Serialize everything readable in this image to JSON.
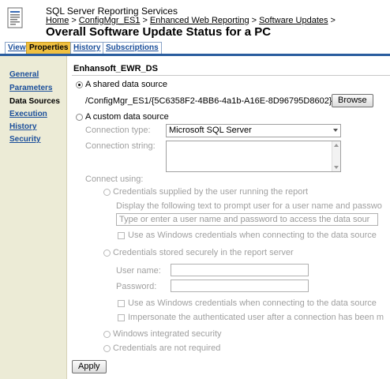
{
  "header": {
    "app_title": "SQL Server Reporting Services",
    "breadcrumbs": [
      "Home",
      "ConfigMgr_ES1",
      "Enhanced Web Reporting",
      "Software Updates"
    ],
    "separator": ">",
    "page_title": "Overall Software Update Status for a PC"
  },
  "tabs": [
    {
      "label": "View"
    },
    {
      "label": "Properties"
    },
    {
      "label": "History"
    },
    {
      "label": "Subscriptions"
    }
  ],
  "sidebar": {
    "items": [
      {
        "label": "General"
      },
      {
        "label": "Parameters"
      },
      {
        "label": "Data Sources"
      },
      {
        "label": "Execution"
      },
      {
        "label": "History"
      },
      {
        "label": "Security"
      }
    ]
  },
  "form": {
    "datasource_name": "Enhansoft_EWR_DS",
    "shared_label": "A shared data source",
    "shared_path": "/ConfigMgr_ES1/{5C6358F2-4BB6-4a1b-A16E-8D96795D8602}",
    "browse_label": "Browse",
    "custom_label": "A custom data source",
    "connection_type_label": "Connection type:",
    "connection_type_value": "Microsoft SQL Server",
    "connection_string_label": "Connection string:",
    "connect_using_label": "Connect using:",
    "cred_user_label": "Credentials supplied by the user running the report",
    "prompt_text_label": "Display the following text to prompt user for a user name and passwo",
    "prompt_placeholder": "Type or enter a user name and password to access the data sour",
    "use_windows_1": "Use as Windows credentials when connecting to the data source",
    "cred_stored_label": "Credentials stored securely in the report server",
    "username_label": "User name:",
    "password_label": "Password:",
    "use_windows_2": "Use as Windows credentials when connecting to the data source",
    "impersonate_label": "Impersonate the authenticated user after a connection has been m",
    "windows_integrated_label": "Windows integrated security",
    "not_required_label": "Credentials are not required",
    "apply_label": "Apply"
  }
}
